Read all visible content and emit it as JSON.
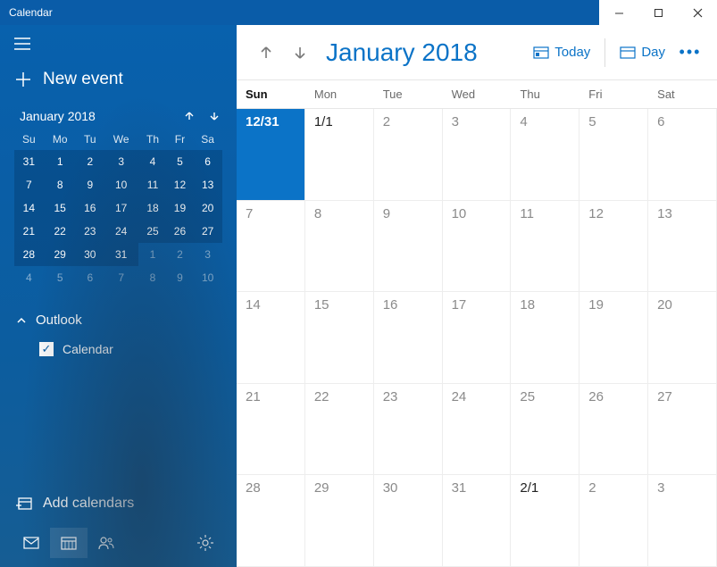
{
  "window": {
    "title": "Calendar"
  },
  "sidebar": {
    "new_event": "New event",
    "mini": {
      "title": "January 2018",
      "dow": [
        "Su",
        "Mo",
        "Tu",
        "We",
        "Th",
        "Fr",
        "Sa"
      ],
      "rows": [
        [
          {
            "d": "31",
            "sel": true,
            "cur": true
          },
          {
            "d": "1",
            "cur": true
          },
          {
            "d": "2",
            "cur": true
          },
          {
            "d": "3",
            "cur": true
          },
          {
            "d": "4",
            "cur": true
          },
          {
            "d": "5",
            "cur": true
          },
          {
            "d": "6",
            "cur": true
          }
        ],
        [
          {
            "d": "7",
            "cur": true
          },
          {
            "d": "8",
            "cur": true
          },
          {
            "d": "9",
            "cur": true
          },
          {
            "d": "10",
            "cur": true
          },
          {
            "d": "11",
            "cur": true
          },
          {
            "d": "12",
            "cur": true
          },
          {
            "d": "13",
            "cur": true
          }
        ],
        [
          {
            "d": "14",
            "cur": true
          },
          {
            "d": "15",
            "cur": true
          },
          {
            "d": "16",
            "cur": true
          },
          {
            "d": "17",
            "cur": true
          },
          {
            "d": "18",
            "cur": true
          },
          {
            "d": "19",
            "cur": true
          },
          {
            "d": "20",
            "cur": true
          }
        ],
        [
          {
            "d": "21",
            "cur": true
          },
          {
            "d": "22",
            "cur": true
          },
          {
            "d": "23",
            "cur": true
          },
          {
            "d": "24",
            "cur": true
          },
          {
            "d": "25",
            "cur": true
          },
          {
            "d": "26",
            "cur": true
          },
          {
            "d": "27",
            "cur": true
          }
        ],
        [
          {
            "d": "28",
            "cur": true
          },
          {
            "d": "29",
            "cur": true
          },
          {
            "d": "30",
            "cur": true
          },
          {
            "d": "31",
            "cur": true
          },
          {
            "d": "1",
            "other": true
          },
          {
            "d": "2",
            "other": true
          },
          {
            "d": "3",
            "other": true
          }
        ],
        [
          {
            "d": "4",
            "other": true
          },
          {
            "d": "5",
            "other": true
          },
          {
            "d": "6",
            "other": true
          },
          {
            "d": "7",
            "other": true
          },
          {
            "d": "8",
            "other": true
          },
          {
            "d": "9",
            "other": true
          },
          {
            "d": "10",
            "other": true
          }
        ]
      ]
    },
    "account_group": "Outlook",
    "account_item": "Calendar",
    "add_calendars": "Add calendars"
  },
  "toolbar": {
    "month": "January 2018",
    "today": "Today",
    "view": "Day"
  },
  "dow": [
    "Sun",
    "Mon",
    "Tue",
    "Wed",
    "Thu",
    "Fri",
    "Sat"
  ],
  "grid": [
    [
      {
        "t": "12/31",
        "today": true
      },
      {
        "t": "1/1",
        "dark": true
      },
      {
        "t": "2"
      },
      {
        "t": "3"
      },
      {
        "t": "4"
      },
      {
        "t": "5"
      },
      {
        "t": "6"
      }
    ],
    [
      {
        "t": "7"
      },
      {
        "t": "8"
      },
      {
        "t": "9"
      },
      {
        "t": "10"
      },
      {
        "t": "11"
      },
      {
        "t": "12"
      },
      {
        "t": "13"
      }
    ],
    [
      {
        "t": "14"
      },
      {
        "t": "15"
      },
      {
        "t": "16"
      },
      {
        "t": "17"
      },
      {
        "t": "18"
      },
      {
        "t": "19"
      },
      {
        "t": "20"
      }
    ],
    [
      {
        "t": "21"
      },
      {
        "t": "22"
      },
      {
        "t": "23"
      },
      {
        "t": "24"
      },
      {
        "t": "25"
      },
      {
        "t": "26"
      },
      {
        "t": "27"
      }
    ],
    [
      {
        "t": "28"
      },
      {
        "t": "29"
      },
      {
        "t": "30"
      },
      {
        "t": "31"
      },
      {
        "t": "2/1",
        "dark": true
      },
      {
        "t": "2"
      },
      {
        "t": "3"
      }
    ]
  ]
}
